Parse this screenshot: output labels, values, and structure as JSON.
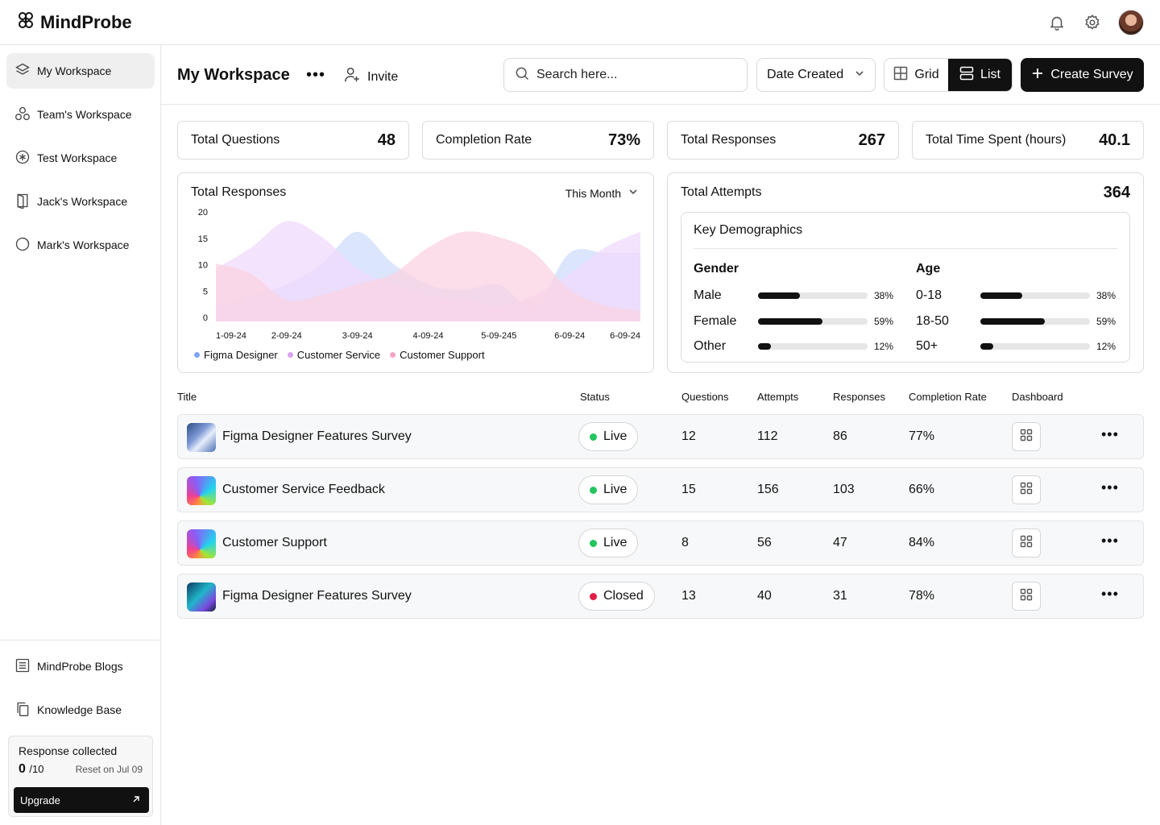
{
  "app": {
    "name": "MindProbe"
  },
  "topbar": {
    "icons": [
      "bell-icon",
      "gear-icon"
    ],
    "avatar": "user-avatar"
  },
  "sidebar": {
    "items": [
      {
        "label": "My Workspace",
        "icon": "layers-icon",
        "active": true
      },
      {
        "label": "Team's Workspace",
        "icon": "team-icon"
      },
      {
        "label": "Test Workspace",
        "icon": "asterisk-icon"
      },
      {
        "label": "Jack's Workspace",
        "icon": "door-icon"
      },
      {
        "label": "Mark's Workspace",
        "icon": "spinner-icon"
      }
    ],
    "bottom": [
      {
        "label": "MindProbe Blogs",
        "icon": "document-icon"
      },
      {
        "label": "Knowledge Base",
        "icon": "copy-icon"
      }
    ],
    "usage": {
      "title": "Response collected",
      "count": "0",
      "max": "/10",
      "reset": "Reset on Jul 09",
      "upgrade": "Upgrade"
    }
  },
  "header": {
    "title": "My Workspace",
    "more": "•••",
    "invite": "Invite",
    "search_placeholder": "Search here...",
    "sort": "Date Created",
    "view": {
      "grid": "Grid",
      "list": "List",
      "selected": "List"
    },
    "create": "Create Survey"
  },
  "stats": [
    {
      "label": "Total Questions",
      "value": "48"
    },
    {
      "label": "Completion Rate",
      "value": "73%"
    },
    {
      "label": "Total Responses",
      "value": "267"
    },
    {
      "label": "Total Time Spent (hours)",
      "value": "40.1"
    }
  ],
  "responses_card": {
    "title": "Total Responses",
    "range": "This Month"
  },
  "chart_data": {
    "type": "area",
    "title": "Total Responses",
    "x": [
      "1-09-24",
      "2-09-24",
      "3-09-24",
      "4-09-24",
      "5-09-245",
      "6-09-24",
      "6-09-24"
    ],
    "yticks": [
      0,
      5,
      10,
      15,
      20
    ],
    "ylim": [
      0,
      20
    ],
    "series": [
      {
        "name": "Figma Designer",
        "color": "#7ea6f4",
        "fill": "#cfdcfb",
        "points": [
          [
            0,
            3
          ],
          [
            0.5,
            5
          ],
          [
            1,
            7
          ],
          [
            1.5,
            11
          ],
          [
            2,
            17
          ],
          [
            2.5,
            11
          ],
          [
            3,
            7
          ],
          [
            3.5,
            6
          ],
          [
            4,
            7
          ],
          [
            4.5,
            3
          ],
          [
            5,
            13
          ],
          [
            5.5,
            13
          ],
          [
            6,
            13
          ]
        ]
      },
      {
        "name": "Customer Service",
        "color": "#d9a3f0",
        "fill": "#f0d9fb",
        "points": [
          [
            0,
            10
          ],
          [
            0.5,
            14
          ],
          [
            1,
            19
          ],
          [
            1.5,
            16
          ],
          [
            2,
            10
          ],
          [
            2.5,
            7
          ],
          [
            3,
            5
          ],
          [
            3.5,
            4
          ],
          [
            4,
            3
          ],
          [
            4.5,
            5
          ],
          [
            5,
            9
          ],
          [
            5.5,
            14
          ],
          [
            6,
            17
          ]
        ]
      },
      {
        "name": "Customer Support",
        "color": "#f5a3c6",
        "fill": "#fbd3e3",
        "points": [
          [
            0,
            11
          ],
          [
            0.5,
            9
          ],
          [
            1,
            4
          ],
          [
            1.5,
            5
          ],
          [
            2,
            7
          ],
          [
            2.5,
            9
          ],
          [
            3,
            14
          ],
          [
            3.5,
            17
          ],
          [
            4,
            16
          ],
          [
            4.5,
            13
          ],
          [
            5,
            6
          ],
          [
            5.5,
            3
          ],
          [
            6,
            2
          ]
        ]
      }
    ],
    "legend": "bottom-left",
    "grid": false
  },
  "attempts_card": {
    "title": "Total Attempts",
    "value": "364",
    "demographics_title": "Key Demographics",
    "gender": {
      "heading": "Gender",
      "rows": [
        {
          "label": "Male",
          "pct": "38%",
          "value": 0.38
        },
        {
          "label": "Female",
          "pct": "59%",
          "value": 0.59
        },
        {
          "label": "Other",
          "pct": "12%",
          "value": 0.12
        }
      ]
    },
    "age": {
      "heading": "Age",
      "rows": [
        {
          "label": "0-18",
          "pct": "38%",
          "value": 0.38
        },
        {
          "label": "18-50",
          "pct": "59%",
          "value": 0.59
        },
        {
          "label": "50+",
          "pct": "12%",
          "value": 0.12
        }
      ]
    }
  },
  "table": {
    "headers": [
      "Title",
      "Status",
      "Questions",
      "Attempts",
      "Responses",
      "Completion Rate",
      "Dashboard"
    ],
    "rows": [
      {
        "title": "Figma Designer Features Survey",
        "status": "Live",
        "status_color": "#22c55e",
        "questions": "12",
        "attempts": "112",
        "responses": "86",
        "completion": "77%",
        "thumb": "blue-abstract"
      },
      {
        "title": "Customer Service Feedback",
        "status": "Live",
        "status_color": "#22c55e",
        "questions": "15",
        "attempts": "156",
        "responses": "103",
        "completion": "66%",
        "thumb": "rainbow-arch"
      },
      {
        "title": "Customer Support",
        "status": "Live",
        "status_color": "#22c55e",
        "questions": "8",
        "attempts": "56",
        "responses": "47",
        "completion": "84%",
        "thumb": "rainbow-arch"
      },
      {
        "title": "Figma Designer Features Survey",
        "status": "Closed",
        "status_color": "#e11d48",
        "questions": "13",
        "attempts": "40",
        "responses": "31",
        "completion": "78%",
        "thumb": "teal-abstract"
      }
    ]
  }
}
